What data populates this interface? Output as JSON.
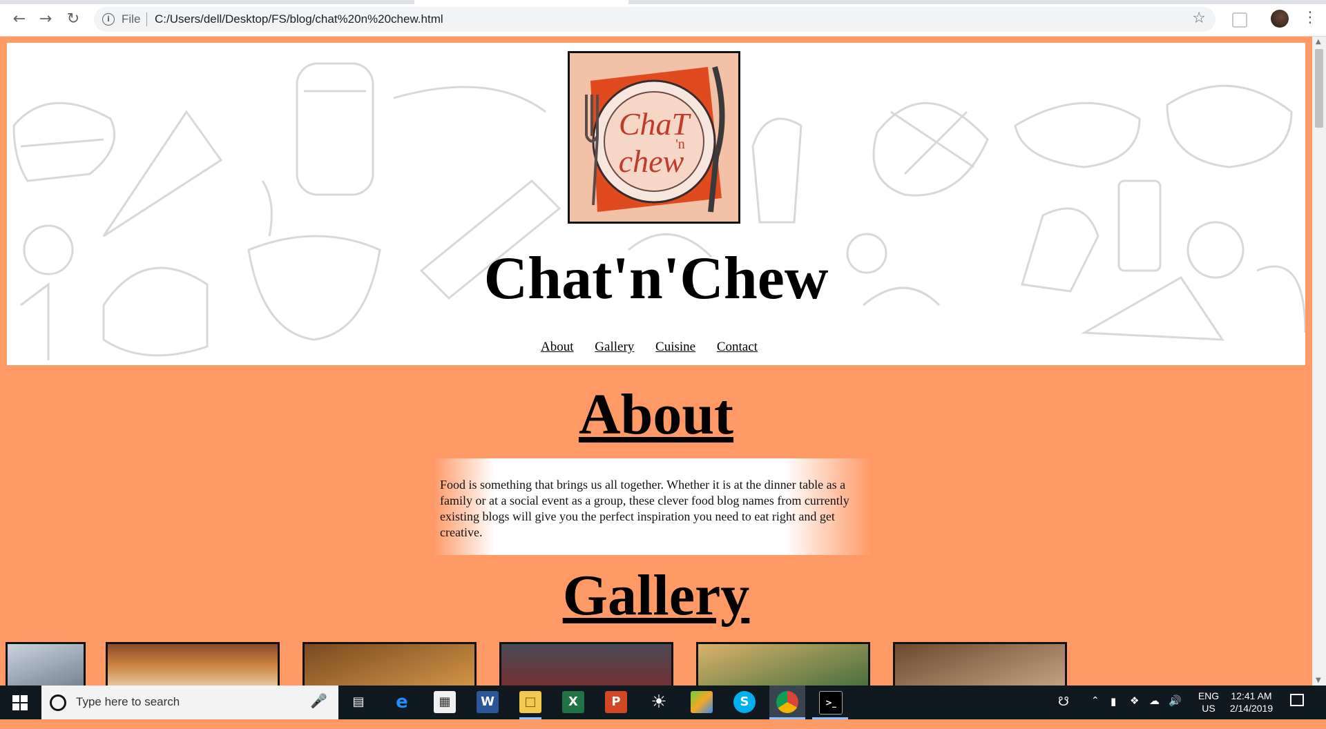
{
  "browser": {
    "file_label": "File",
    "url": "C:/Users/dell/Desktop/FS/blog/chat%20n%20chew.html"
  },
  "site": {
    "logo_text": "Chat 'n chew",
    "title": "Chat'n'Chew",
    "nav": [
      "About",
      "Gallery",
      "Cuisine",
      "Contact"
    ]
  },
  "about": {
    "heading": "About",
    "text": "Food is something that brings us all together. Whether it is at the dinner table as a family or at a social event as a group, these clever food blog names from currently existing blogs will give you the perfect inspiration you need to eat right and get creative."
  },
  "gallery": {
    "heading": "Gallery",
    "thumbnails": [
      {
        "color": "#8a99a6"
      },
      {
        "color": "#a0522d"
      },
      {
        "color": "#b97a3a"
      },
      {
        "color": "#5a4a4a"
      },
      {
        "color": "#6b7d4a"
      },
      {
        "color": "#6b4a30"
      }
    ]
  },
  "taskbar": {
    "search_placeholder": "Type here to search",
    "lang_primary": "ENG",
    "lang_secondary": "US",
    "time": "12:41 AM",
    "date": "2/14/2019"
  },
  "colors": {
    "page_bg": "#ff9966",
    "taskbar_bg": "#101820"
  }
}
